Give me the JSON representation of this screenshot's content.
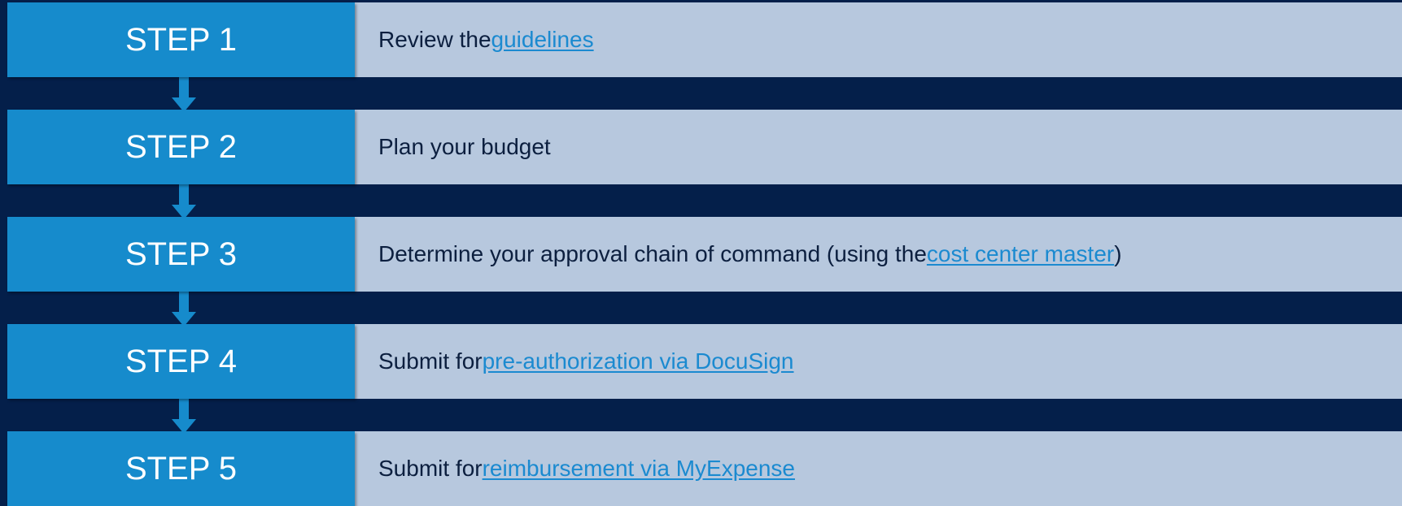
{
  "colors": {
    "background": "#041f4a",
    "step_fill": "#168bcc",
    "description_fill": "#b7c8de",
    "description_text": "#0c1f3f",
    "link": "#1b8ad0"
  },
  "steps": [
    {
      "label": "STEP 1",
      "text_before": "Review the ",
      "link_text": "guidelines",
      "text_after": ""
    },
    {
      "label": "STEP 2",
      "text_before": "Plan your budget",
      "link_text": "",
      "text_after": ""
    },
    {
      "label": "STEP 3",
      "text_before": "Determine your approval chain of command (using the ",
      "link_text": "cost center master",
      "text_after": ")"
    },
    {
      "label": "STEP 4",
      "text_before": "Submit for ",
      "link_text": "pre-authorization via DocuSign",
      "text_after": ""
    },
    {
      "label": "STEP 5",
      "text_before": "Submit for ",
      "link_text": "reimbursement via MyExpense",
      "text_after": ""
    }
  ]
}
